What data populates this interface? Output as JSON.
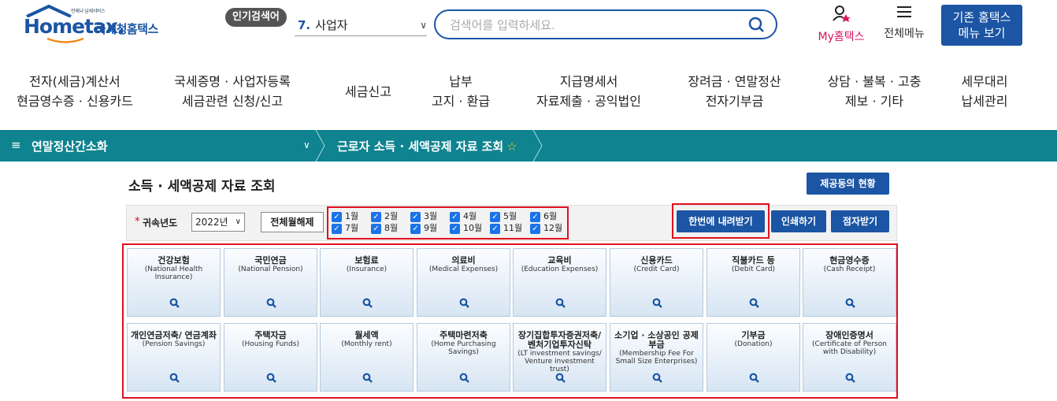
{
  "header": {
    "logo_tagline": "언제냐 납세서비스",
    "logo_text": "Hometax.",
    "logo_sub": "국세청홈택스",
    "popular_badge": "인기검색어",
    "popular_rank": "7.",
    "popular_term": "사업자",
    "search_placeholder": "검색어를 입력하세요.",
    "my_hometax": "My홈택스",
    "all_menu": "전체메뉴",
    "old_menu_line1": "기존 홈택스",
    "old_menu_line2": "메뉴 보기"
  },
  "nav": [
    {
      "line1": "전자(세금)계산서",
      "line2": "현금영수증 · 신용카드"
    },
    {
      "line1": "국세증명 · 사업자등록",
      "line2": "세금관련 신청/신고"
    },
    {
      "line1": "세금신고",
      "line2": ""
    },
    {
      "line1": "납부",
      "line2": "고지 · 환급"
    },
    {
      "line1": "지급명세서",
      "line2": "자료제출 · 공익법인"
    },
    {
      "line1": "장려금 · 연말정산",
      "line2": "전자기부금"
    },
    {
      "line1": "상담 · 불복 · 고충",
      "line2": "제보 · 기타"
    },
    {
      "line1": "세무대리",
      "line2": "납세관리"
    }
  ],
  "breadcrumb": {
    "menu_icon": "≡",
    "section": "연말정산간소화",
    "page": "근로자 소득 · 세액공제 자료 조회"
  },
  "content": {
    "title": "소득 · 세액공제 자료 조회",
    "status_button": "제공동의 현황",
    "year_label": "귀속년도",
    "year_value": "2022년",
    "deselect_all": "전체월해제",
    "months": [
      "1월",
      "2월",
      "3월",
      "4월",
      "5월",
      "6월",
      "7월",
      "8월",
      "9월",
      "10월",
      "11월",
      "12월"
    ],
    "download_all": "한번에 내려받기",
    "print": "인쇄하기",
    "dot_receive": "점자받기"
  },
  "tiles": [
    {
      "ko": "건강보험",
      "en": "(National Health Insurance)"
    },
    {
      "ko": "국민연금",
      "en": "(National Pension)"
    },
    {
      "ko": "보험료",
      "en": "(Insurance)"
    },
    {
      "ko": "의료비",
      "en": "(Medical Expenses)"
    },
    {
      "ko": "교육비",
      "en": "(Education Expenses)"
    },
    {
      "ko": "신용카드",
      "en": "(Credit Card)"
    },
    {
      "ko": "직불카드 등",
      "en": "(Debit Card)"
    },
    {
      "ko": "현금영수증",
      "en": "(Cash Receipt)"
    },
    {
      "ko": "개인연금저축/ 연금계좌",
      "en": "(Pension Savings)"
    },
    {
      "ko": "주택자금",
      "en": "(Housing Funds)"
    },
    {
      "ko": "월세액",
      "en": "(Monthly rent)"
    },
    {
      "ko": "주택마련저축",
      "en": "(Home Purchasing Savings)"
    },
    {
      "ko": "장기집합투자증권저축/ 벤처기업투자신탁",
      "en": "(LT investment savings/ Venture investment trust)"
    },
    {
      "ko": "소기업 · 소상공인 공제부금",
      "en": "(Membership Fee For Small Size Enterprises)"
    },
    {
      "ko": "기부금",
      "en": "(Donation)"
    },
    {
      "ko": "장애인증명서",
      "en": "(Certificate of Person with Disability)"
    }
  ],
  "colors": {
    "brand_blue": "#1b55a4",
    "teal_bar": "#0f8390",
    "highlight_red": "#e0101e",
    "my_pink": "#d9175f"
  }
}
